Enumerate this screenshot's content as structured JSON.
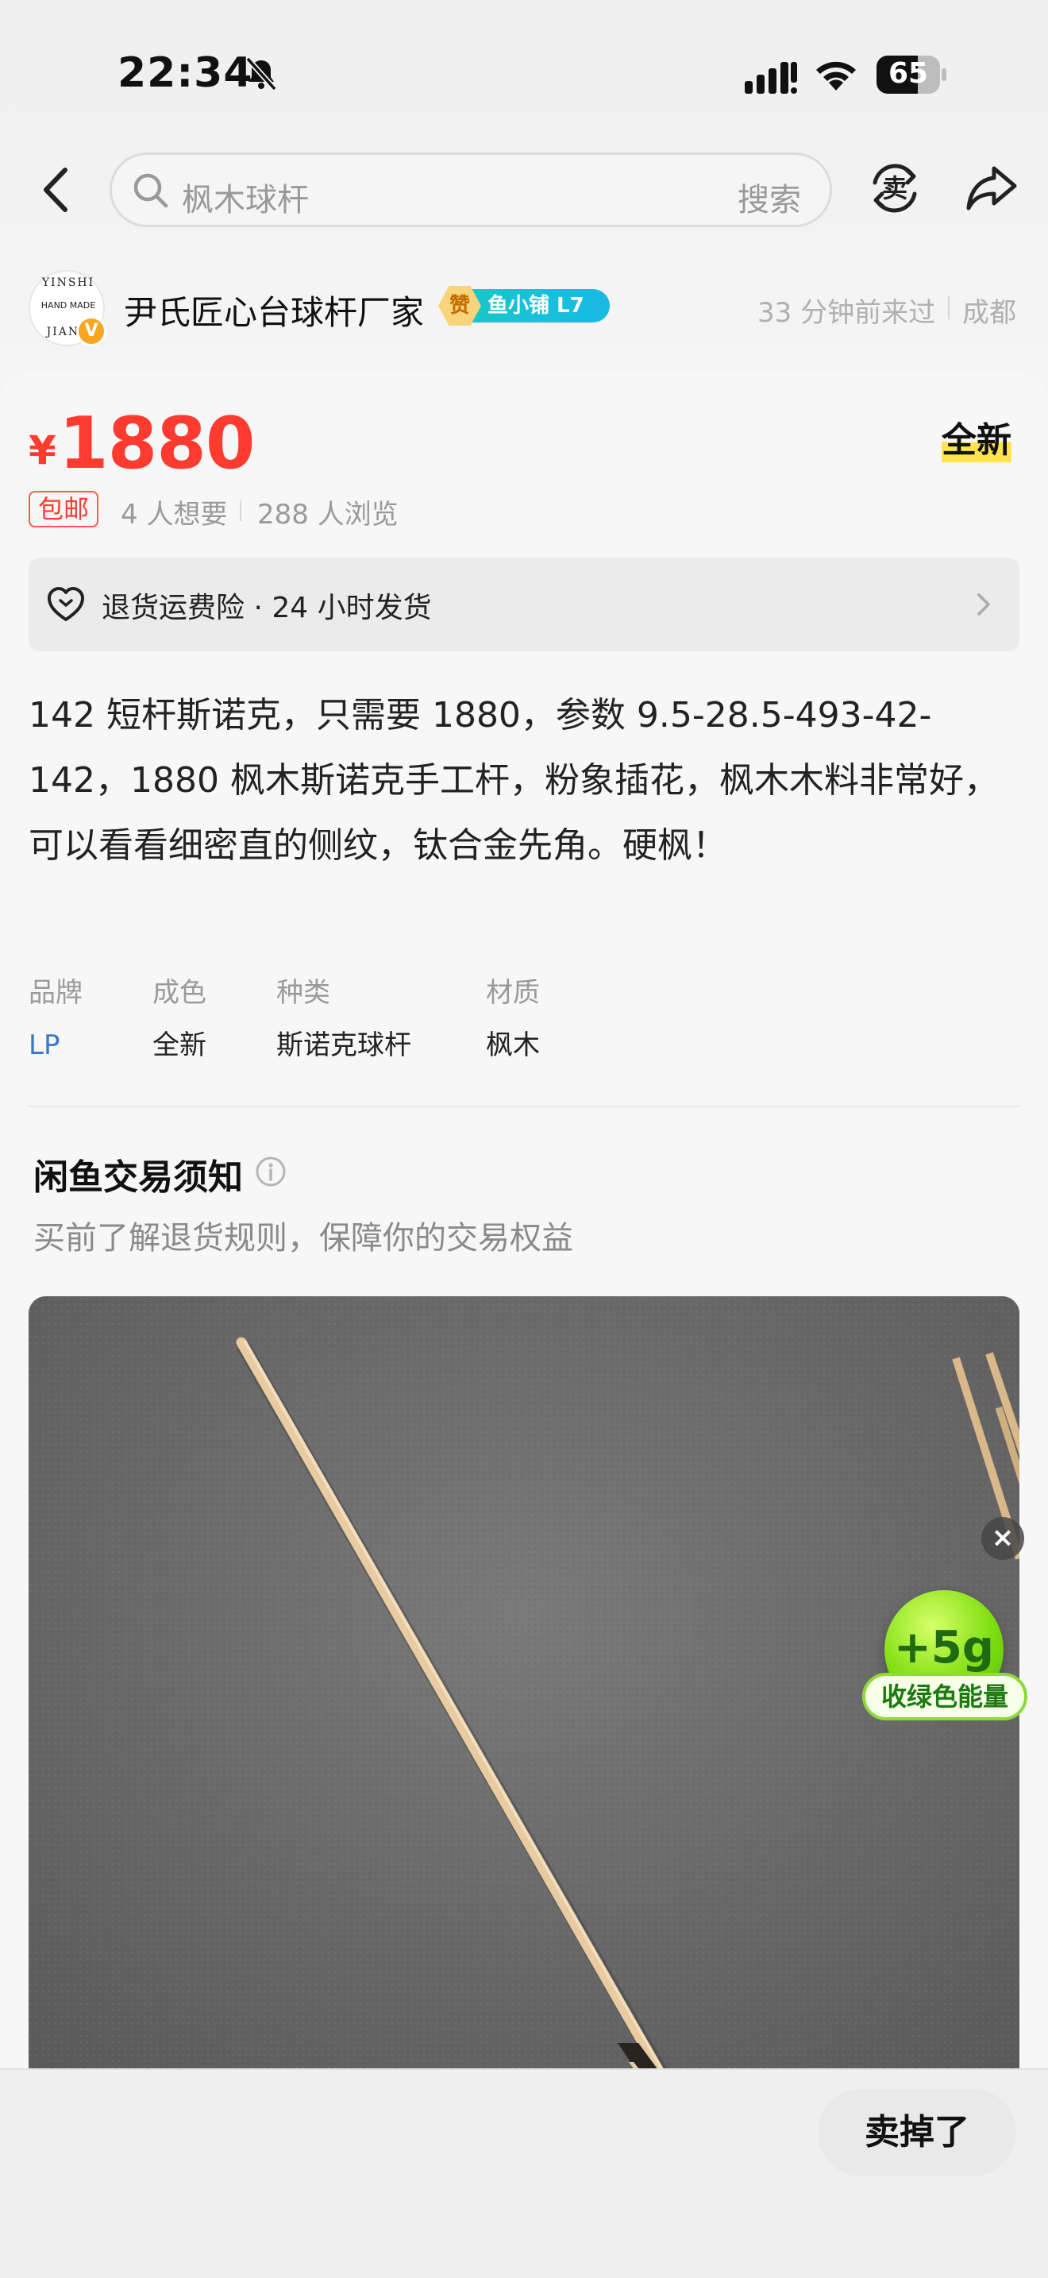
{
  "status_bar": {
    "time": "22:34",
    "battery": "65",
    "battery_level": 0.65
  },
  "nav": {
    "search_placeholder": "枫木球杆",
    "search_button": "搜索",
    "sell_label": "卖"
  },
  "seller": {
    "name": "尹氏匠心台球杆厂家",
    "avatar_text": {
      "top": "YINSHI",
      "middle": "HAND MADE",
      "bottom": "JIANG",
      "badge": "V"
    },
    "badge_icon": "赞",
    "badge_level": "鱼小铺 L7",
    "last_seen": "33 分钟前来过",
    "city": "成都"
  },
  "item": {
    "currency": "¥",
    "price": "1880",
    "condition": "全新",
    "free_shipping": "包邮",
    "wants": "4 人想要",
    "views": "288 人浏览",
    "guarantee": "退货运费险 · 24 小时发货",
    "description": "142 短杆斯诺克，只需要 1880，参数 9.5-28.5-493-42-142，1880 枫木斯诺克手工杆，粉象插花，枫木木料非常好，可以看看细密直的侧纹，钛合金先角。硬枫！",
    "specs": [
      {
        "key": "品牌",
        "value": "LP"
      },
      {
        "key": "成色",
        "value": "全新"
      },
      {
        "key": "种类",
        "value": "斯诺克球杆"
      },
      {
        "key": "材质",
        "value": "枫木"
      }
    ]
  },
  "notice": {
    "title": "闲鱼交易须知",
    "subtitle": "买前了解退货规则，保障你的交易权益"
  },
  "energy": {
    "close": "×",
    "amount": "+5g",
    "label": "收绿色能量"
  },
  "bottom_bar": {
    "sold_button": "卖掉了"
  },
  "colors": {
    "price_red": "#ff3b30",
    "link_blue": "#3a78c9",
    "badge_teal": "#18c7c9",
    "highlight_yellow": "#ffe44d"
  },
  "icons": [
    "bell-slash-icon",
    "signal-icon",
    "wifi-icon",
    "battery-icon",
    "back-arrow-icon",
    "search-icon",
    "sell-icon",
    "share-icon",
    "heart-shield-icon",
    "chevron-right-icon",
    "info-icon",
    "close-icon"
  ]
}
